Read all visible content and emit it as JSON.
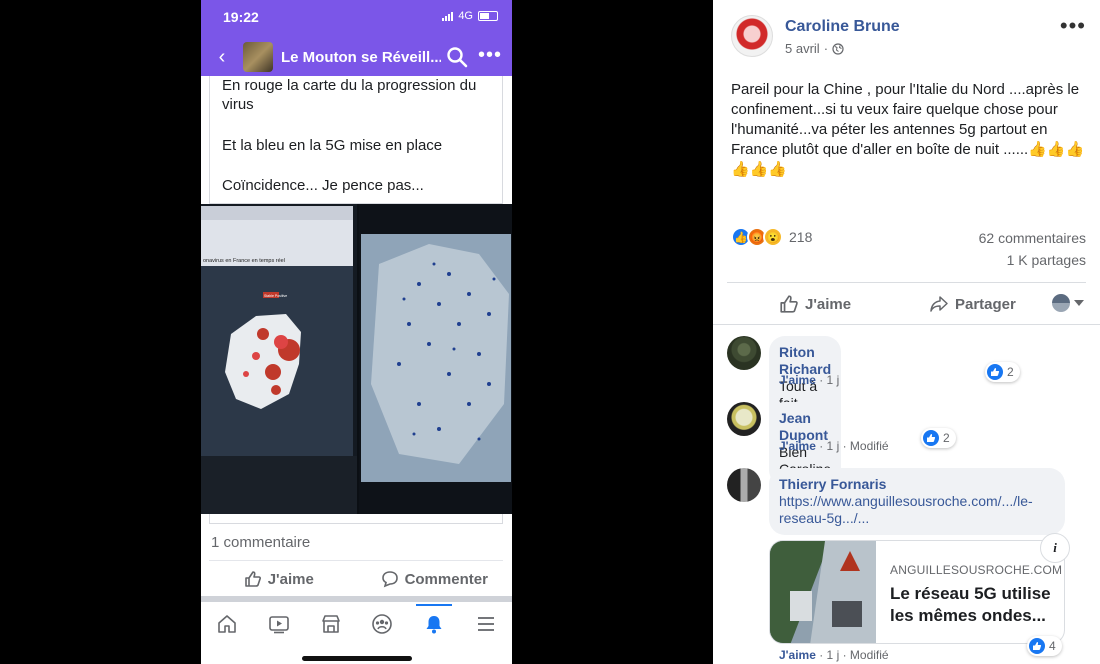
{
  "phone": {
    "status": {
      "time": "19:22",
      "network": "4G"
    },
    "appbar": {
      "title": "Le Mouton se Réveill..."
    },
    "post": {
      "lines": [
        "En rouge la carte du la progression du virus",
        "Et la bleu en la 5G mise en place",
        "Coïncidence... Je pence pas..."
      ],
      "comment_count": "1 commentaire",
      "like_label": "J'aime",
      "comment_label": "Commenter"
    },
    "photo_captions": {
      "left_title": "onavirus en France en temps réel",
      "left_status": "Stable Positive"
    }
  },
  "fb_post": {
    "author": "Caroline Brune",
    "date": "5 avril",
    "text": "Pareil pour la Chine , pour l'Italie du Nord ....après le confinement...si tu veux faire quelque chose pour l'humanité...va péter les antennes 5g partout en France plutôt que d'aller en boîte de nuit ......👍👍👍👍👍👍",
    "reaction_count": "218",
    "comments_count": "62 commentaires",
    "shares_count": "1 K partages",
    "like_label": "J'aime",
    "share_label": "Partager",
    "colors": {
      "accent": "#1877f2",
      "name": "#385898",
      "purple": "#7b56e8"
    }
  },
  "comments": [
    {
      "name": "Riton Richard",
      "text": "Tout à fait d'accord 👍",
      "like": "J'aime",
      "meta": " · 1 j",
      "reactions": "2"
    },
    {
      "name": "Jean Dupont",
      "text": "Bien Caroline",
      "like": "J'aime",
      "meta": " · 1 j · Modifié",
      "reactions": "2"
    },
    {
      "name": "Thierry Fornaris",
      "link": "https://www.anguillesousroche.com/.../le-reseau-5g.../...",
      "like": "J'aime",
      "meta": " · 1 j · Modifié",
      "reactions": "4",
      "card": {
        "domain": "ANGUILLESOUSROCHE.COM",
        "title": "Le réseau 5G utilise les mêmes ondes..."
      }
    }
  ]
}
